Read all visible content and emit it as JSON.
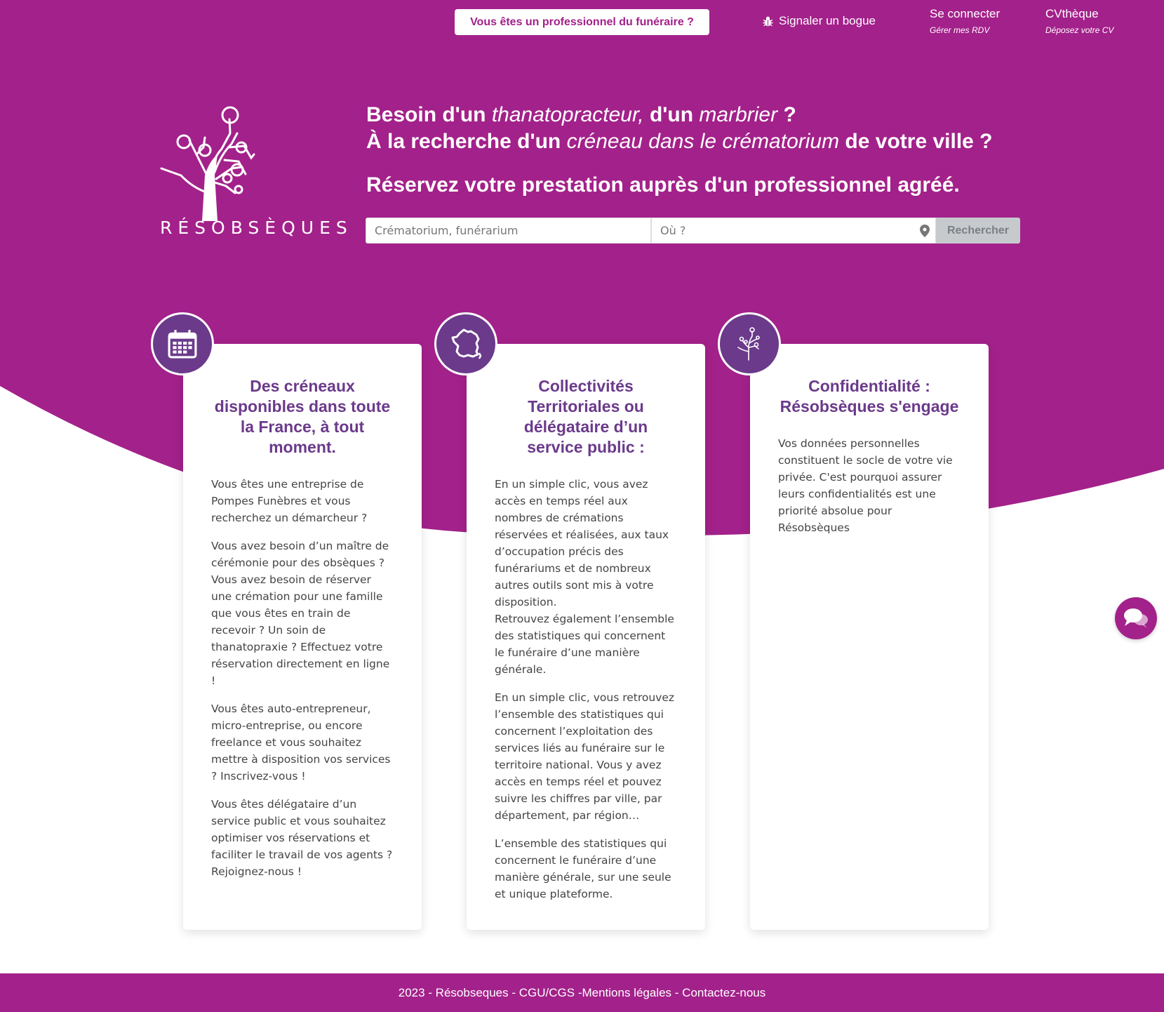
{
  "colors": {
    "brand": "#a3218a",
    "accent_purple": "#6b3a8b",
    "white": "#ffffff"
  },
  "nav": {
    "pro_button": "Vous êtes un professionnel du funéraire ?",
    "bug_label": "Signaler un bogue",
    "bug_icon": "bug-icon",
    "connect_label": "Se connecter",
    "connect_sub": "Gérer mes RDV",
    "cv_label": "CVthèque",
    "cv_sub": "Déposez votre CV"
  },
  "logo": {
    "text": "RÉSOBSÈQUES"
  },
  "headline": {
    "l1_a": "Besoin d'un ",
    "l1_b": "thanatopracteur,",
    "l1_c": " d'un ",
    "l1_d": "marbrier",
    "l1_e": " ?",
    "l2_a": "À la recherche d'un ",
    "l2_b": "créneau dans le crématorium",
    "l2_c": " de votre ville ?",
    "l3": "Réservez votre prestation auprès d'un professionnel agréé."
  },
  "search": {
    "what_placeholder": "Crématorium, funérarium",
    "where_placeholder": "Où ?",
    "button": "Rechercher"
  },
  "cards": [
    {
      "icon": "calendar-icon",
      "title": "Des créneaux disponibles dans toute la France, à tout moment.",
      "paragraphs": [
        "Vous êtes une entreprise de Pompes Funèbres et vous recherchez un démarcheur ?",
        "Vous avez besoin d’un maître de cérémonie pour des obsèques ? Vous avez besoin de réserver une crémation pour une famille que vous êtes en train de recevoir ? Un soin de thanatopraxie ? Effectuez votre réservation directement en ligne !",
        "Vous êtes auto-entrepreneur, micro-entreprise, ou encore freelance et vous souhaitez mettre à disposition vos services ? Inscrivez-vous !",
        "Vous êtes délégataire d’un service public et vous souhaitez optimiser vos réservations et faciliter le travail de vos agents ? Rejoignez-nous !"
      ]
    },
    {
      "icon": "france-map-icon",
      "title": "Collectivités Territoriales ou délégataire d’un service public :",
      "paragraphs": [
        "En un simple clic, vous avez accès en temps réel aux nombres de crémations réservées et réalisées, aux taux d’occupation précis des funérariums et de nombreux autres outils sont mis à votre disposition.",
        "Retrouvez également l’ensemble des statistiques qui concernent le funéraire d’une manière générale.",
        "En un simple clic, vous retrouvez l’ensemble des statistiques qui concernent l’exploitation des services liés au funéraire sur le territoire national. Vous y avez accès en temps réel et pouvez suivre les chiffres par ville, par département, par région…",
        "L’ensemble des statistiques qui concernent le funéraire d’une manière générale, sur une seule et unique plateforme."
      ]
    },
    {
      "icon": "tree-icon",
      "title": "Confidentialité : Résobsèques s'engage",
      "paragraphs": [
        "Vos données personnelles constituent le socle de votre vie privée. C'est pourquoi assurer leurs confidentialités est une priorité absolue pour Résobsèques"
      ]
    }
  ],
  "footer": {
    "year": "2023",
    "brand": "Résobseques",
    "cgu": "CGU/CGS",
    "mentions": "Mentions légales",
    "contact": "Contactez-nous"
  }
}
